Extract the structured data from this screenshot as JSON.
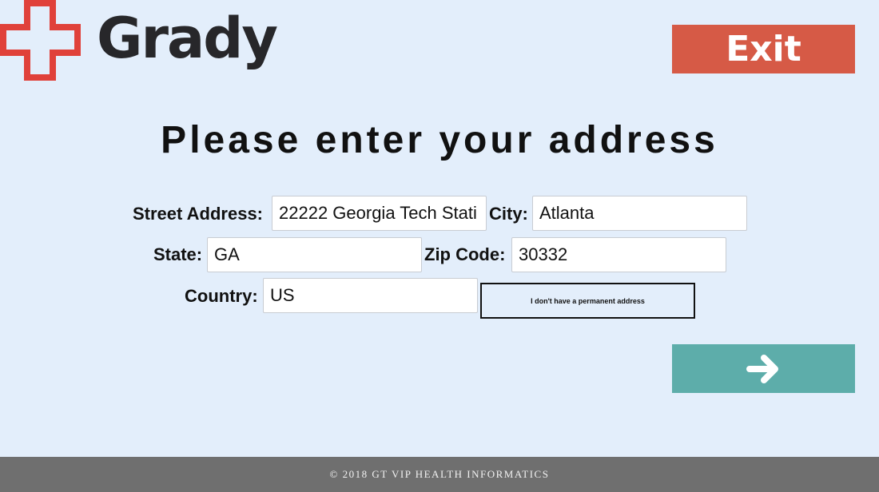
{
  "header": {
    "logo_text": "Grady",
    "exit_label": "Exit"
  },
  "main": {
    "title": "Please enter your address",
    "fields": {
      "street": {
        "label": "Street Address:",
        "value": "22222 Georgia Tech Stati"
      },
      "city": {
        "label": "City:",
        "value": "Atlanta"
      },
      "state": {
        "label": "State:",
        "value": "GA"
      },
      "zip": {
        "label": "Zip Code:",
        "value": "30332"
      },
      "country": {
        "label": "Country:",
        "value": "US"
      }
    },
    "no_address_label": "I don't have a permanent address",
    "next_icon": "arrow-right-icon"
  },
  "footer": {
    "text": "© 2018 GT VIP HEALTH INFORMATICS"
  },
  "colors": {
    "background": "#e3eefb",
    "logo_cross": "#e0413a",
    "exit_button": "#d65a46",
    "next_button": "#5dadaa",
    "footer": "#6f6f6f"
  }
}
